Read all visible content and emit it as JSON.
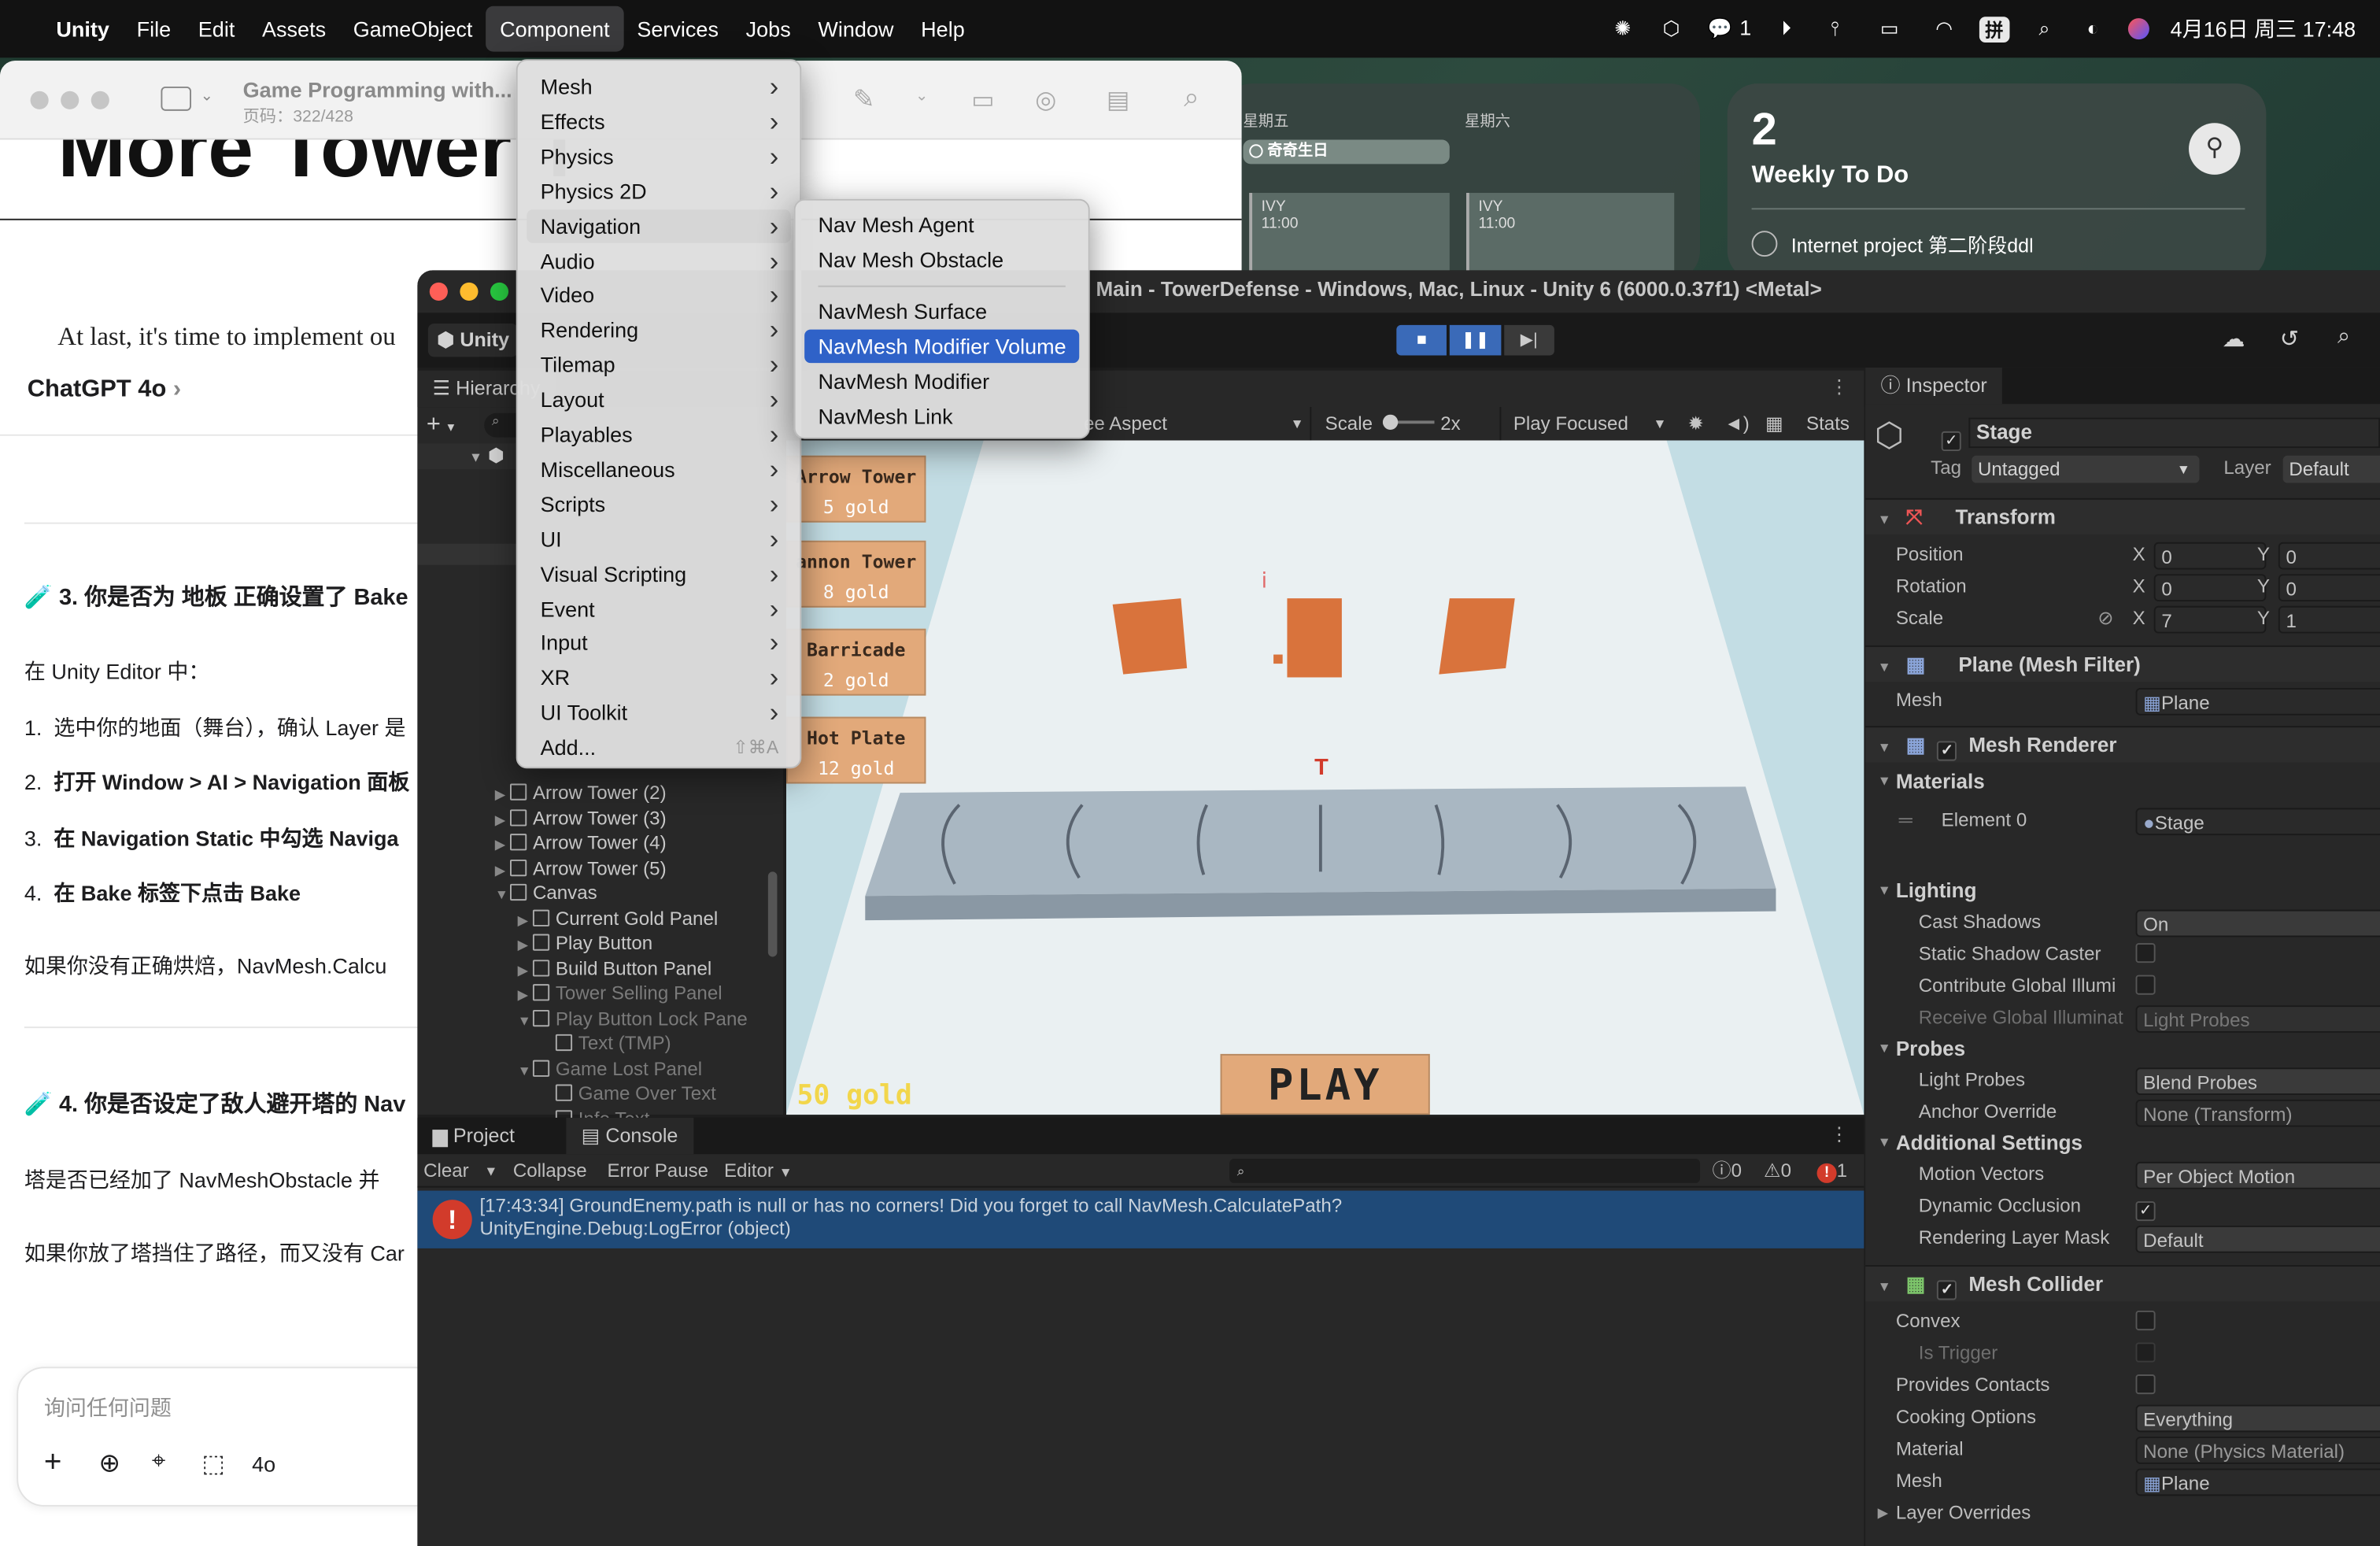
{
  "menubar": {
    "app": "Unity",
    "items": [
      "File",
      "Edit",
      "Assets",
      "GameObject",
      "Component",
      "Services",
      "Jobs",
      "Window",
      "Help"
    ],
    "active": "Component",
    "wechat_count": "1",
    "ime": "拼",
    "datetime": "4月16日 周三 17:48"
  },
  "calendar_widget": {
    "day1": "星期五",
    "day2": "星期六",
    "event1": "奇奇生日",
    "slot1_title": "IVY",
    "slot1_time": "11:00",
    "slot2_title": "IVY",
    "slot2_time": "11:00"
  },
  "todo_widget": {
    "count": "2",
    "title": "Weekly To Do",
    "item": "Internet project 第二阶段ddl"
  },
  "book": {
    "title": "Game Programming with...",
    "page": "页码：322/428",
    "heading": "More Tower T",
    "body": "At last, it's time to implement ou"
  },
  "chat": {
    "header": "ChatGPT 4o",
    "h3": "3. 你是否为 地板 正确设置了 Bake",
    "p1": "在 Unity Editor 中：",
    "steps": [
      {
        "n": "1.",
        "text": "选中你的地面（舞台），确认 Layer 是"
      },
      {
        "n": "2.",
        "text": "打开 Window > AI > Navigation 面板"
      },
      {
        "n": "3.",
        "text": "在 Navigation Static 中勾选 Naviga"
      },
      {
        "n": "4.",
        "text": "在 Bake 标签下点击 Bake"
      }
    ],
    "p2": "如果你没有正确烘焙，NavMesh.Calcu",
    "h4": "4. 你是否设定了敌人避开塔的 Nav",
    "p3": "塔是否已经加了 NavMeshObstacle 并",
    "p4": "如果你放了塔挡住了路径，而又没有 Car",
    "input_placeholder": "询问任何问题",
    "model": "4o"
  },
  "unity": {
    "title": "Main - TowerDefense - Windows, Mac, Linux - Unity 6 (6000.0.37f1) <Metal>",
    "account_short": "Unity",
    "hierarchy_tab": "Hierarchy",
    "hierarchy": [
      {
        "label": "Arrow Tower (2)",
        "indent": 0,
        "dim": false,
        "expand": "right"
      },
      {
        "label": "Arrow Tower (3)",
        "indent": 0,
        "dim": false,
        "expand": "right"
      },
      {
        "label": "Arrow Tower (4)",
        "indent": 0,
        "dim": false,
        "expand": "right"
      },
      {
        "label": "Arrow Tower (5)",
        "indent": 0,
        "dim": false,
        "expand": "right"
      },
      {
        "label": "Canvas",
        "indent": 0,
        "dim": false,
        "expand": "down"
      },
      {
        "label": "Current Gold Panel",
        "indent": 1,
        "dim": false,
        "expand": "right"
      },
      {
        "label": "Play Button",
        "indent": 1,
        "dim": false,
        "expand": "right"
      },
      {
        "label": "Build Button Panel",
        "indent": 1,
        "dim": false,
        "expand": "right"
      },
      {
        "label": "Tower Selling Panel",
        "indent": 1,
        "dim": true,
        "expand": "right"
      },
      {
        "label": "Play Button Lock Pane",
        "indent": 1,
        "dim": true,
        "expand": "down"
      },
      {
        "label": "Text (TMP)",
        "indent": 2,
        "dim": true,
        "expand": ""
      },
      {
        "label": "Game Lost Panel",
        "indent": 1,
        "dim": true,
        "expand": "down"
      },
      {
        "label": "Game Over Text",
        "indent": 2,
        "dim": true,
        "expand": ""
      },
      {
        "label": "Info Text",
        "indent": 2,
        "dim": true,
        "expand": ""
      }
    ],
    "game_toolbar": {
      "aspect": "ee Aspect",
      "scale_label": "Scale",
      "scale_value": "2x",
      "play_focused": "Play Focused",
      "stats": "Stats"
    },
    "shop": [
      {
        "name": "Arrow Tower",
        "price": "5 gold"
      },
      {
        "name": "annon Tower",
        "price": "8 gold"
      },
      {
        "name": "Barricade",
        "price": "2 gold"
      },
      {
        "name": "Hot Plate",
        "price": "12 gold"
      }
    ],
    "gold": "50 gold",
    "play": "PLAY",
    "console": {
      "project_tab": "Project",
      "console_tab": "Console",
      "clear": "Clear",
      "collapse": "Collapse",
      "error_pause": "Error Pause",
      "editor": "Editor",
      "log_count": "0",
      "warn_count": "0",
      "error_count": "1",
      "message_line1": "[17:43:34] GroundEnemy.path is null or has no corners! Did you forget to call NavMesh.CalculatePath?",
      "message_line2": "UnityEngine.Debug:LogError (object)"
    },
    "inspector": {
      "tab": "Inspector",
      "object_name": "Stage",
      "tag_label": "Tag",
      "tag_value": "Untagged",
      "layer_label": "Layer",
      "layer_value": "Default",
      "transform": "Transform",
      "position": "Position",
      "rotation": "Rotation",
      "scale": "Scale",
      "pos_x": "0",
      "pos_y": "0",
      "rot_x": "0",
      "rot_y": "0",
      "scl_x": "7",
      "scl_y": "1",
      "axis_x": "X",
      "axis_y": "Y",
      "mesh_filter": "Plane (Mesh Filter)",
      "mesh_label": "Mesh",
      "mesh_value": "Plane",
      "mesh_renderer": "Mesh Renderer",
      "materials": "Materials",
      "element0": "Element 0",
      "element0_value": "Stage",
      "lighting": "Lighting",
      "cast_shadows": "Cast Shadows",
      "cast_shadows_value": "On",
      "static_shadow": "Static Shadow Caster",
      "contribute_gi": "Contribute Global Illumi",
      "receive_gi": "Receive Global Illuminat",
      "receive_gi_value": "Light Probes",
      "probes": "Probes",
      "light_probes": "Light Probes",
      "light_probes_value": "Blend Probes",
      "anchor_override": "Anchor Override",
      "anchor_override_value": "None (Transform)",
      "additional_settings": "Additional Settings",
      "motion_vectors": "Motion Vectors",
      "motion_vectors_value": "Per Object Motion",
      "dynamic_occlusion": "Dynamic Occlusion",
      "rendering_layer_mask": "Rendering Layer Mask",
      "rendering_layer_mask_value": "Default",
      "mesh_collider": "Mesh Collider",
      "convex": "Convex",
      "is_trigger": "Is Trigger",
      "provides_contacts": "Provides Contacts",
      "cooking_options": "Cooking Options",
      "cooking_options_value": "Everything",
      "material": "Material",
      "material_value": "None (Physics Material)",
      "collider_mesh": "Mesh",
      "collider_mesh_value": "Plane",
      "layer_overrides": "Layer Overrides"
    }
  },
  "component_menu": {
    "items": [
      {
        "label": "Mesh",
        "arrow": true
      },
      {
        "label": "Effects",
        "arrow": true
      },
      {
        "label": "Physics",
        "arrow": true
      },
      {
        "label": "Physics 2D",
        "arrow": true
      },
      {
        "label": "Navigation",
        "arrow": true
      },
      {
        "label": "Audio",
        "arrow": true
      },
      {
        "label": "Video",
        "arrow": true
      },
      {
        "label": "Rendering",
        "arrow": true
      },
      {
        "label": "Tilemap",
        "arrow": true
      },
      {
        "label": "Layout",
        "arrow": true
      },
      {
        "label": "Playables",
        "arrow": true
      },
      {
        "label": "Miscellaneous",
        "arrow": true
      },
      {
        "label": "Scripts",
        "arrow": true
      },
      {
        "label": "UI",
        "arrow": true
      },
      {
        "label": "Visual Scripting",
        "arrow": true
      },
      {
        "label": "Event",
        "arrow": true
      },
      {
        "label": "Input",
        "arrow": true
      },
      {
        "label": "XR",
        "arrow": true
      },
      {
        "label": "UI Toolkit",
        "arrow": true
      },
      {
        "label": "Add...",
        "arrow": false
      }
    ],
    "highlighted": "Navigation",
    "add_shortcut": "⇧⌘A"
  },
  "navigation_submenu": {
    "group1": [
      "Nav Mesh Agent",
      "Nav Mesh Obstacle"
    ],
    "group2": [
      "NavMesh Surface",
      "NavMesh Modifier Volume",
      "NavMesh Modifier",
      "NavMesh Link"
    ],
    "selected": "NavMesh Modifier Volume"
  },
  "colors": {
    "menu_selection": "#2f62c8",
    "console_error_bg": "#1f4a78",
    "error_red": "#d23b2b",
    "shop_button": "#e2a97a",
    "gold_text": "#f2d64b",
    "tower_orange": "#d9733c"
  }
}
